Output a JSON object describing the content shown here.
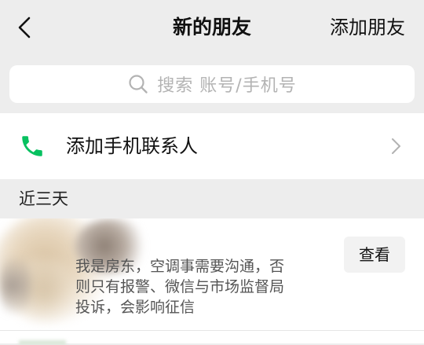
{
  "nav": {
    "title": "新的朋友",
    "action_label": "添加朋友"
  },
  "search": {
    "placeholder": "搜索 账号/手机号"
  },
  "add_contacts": {
    "label": "添加手机联系人",
    "icon": "phone-icon",
    "icon_color": "#07c160"
  },
  "sections": [
    {
      "header": "近三天",
      "requests": [
        {
          "message_lines": [
            "我是房东，空调事需要沟通，否",
            "则只有报警、微信与市场监督局",
            "投诉，会影响征信"
          ],
          "button_label": "查看"
        }
      ]
    }
  ],
  "colors": {
    "background": "#ededed",
    "card": "#ffffff",
    "placeholder_text": "#b3b3b3",
    "secondary_text": "#555555"
  }
}
